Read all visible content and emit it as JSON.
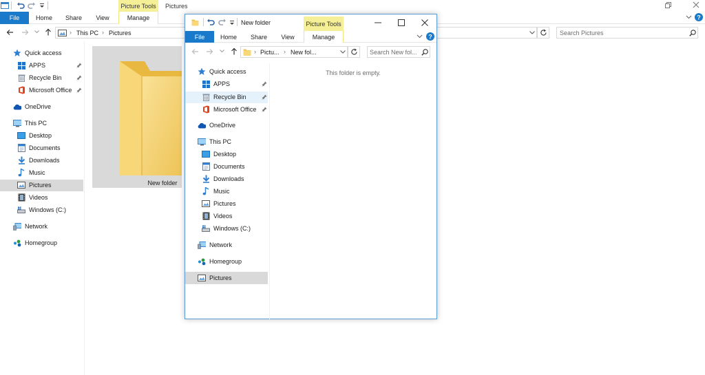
{
  "back_window": {
    "ribbon": {
      "context_label": "Picture Tools",
      "title": "Pictures",
      "tabs": [
        "File",
        "Home",
        "Share",
        "View",
        "Manage"
      ]
    },
    "address": {
      "crumbs": [
        "This PC",
        "Pictures"
      ],
      "search_placeholder": "Search Pictures"
    },
    "nav": {
      "items": [
        "Quick access",
        "APPS",
        "Recycle Bin",
        "Microsoft Office",
        "OneDrive",
        "This PC",
        "Desktop",
        "Documents",
        "Downloads",
        "Music",
        "Pictures",
        "Videos",
        "Windows (C:)",
        "Network",
        "Homegroup"
      ]
    },
    "content": {
      "folder_label": "New folder"
    }
  },
  "front_window": {
    "title": "New folder",
    "context_label": "Picture Tools",
    "tabs": [
      "File",
      "Home",
      "Share",
      "View",
      "Manage"
    ],
    "address": {
      "crumbs": [
        "Pictu...",
        "New fol..."
      ],
      "search_placeholder": "Search New fol..."
    },
    "nav": {
      "items": [
        "Quick access",
        "APPS",
        "Recycle Bin",
        "Microsoft Office",
        "OneDrive",
        "This PC",
        "Desktop",
        "Documents",
        "Downloads",
        "Music",
        "Pictures",
        "Videos",
        "Windows (C:)",
        "Network",
        "Homegroup",
        "Pictures"
      ]
    },
    "empty_message": "This folder is empty."
  },
  "colors": {
    "file_tab": "#1979ca",
    "context_tab": "#f5ef98",
    "selection": "#d9d9d9",
    "hover": "#e5f1fb",
    "accent": "#5a9bd6"
  }
}
